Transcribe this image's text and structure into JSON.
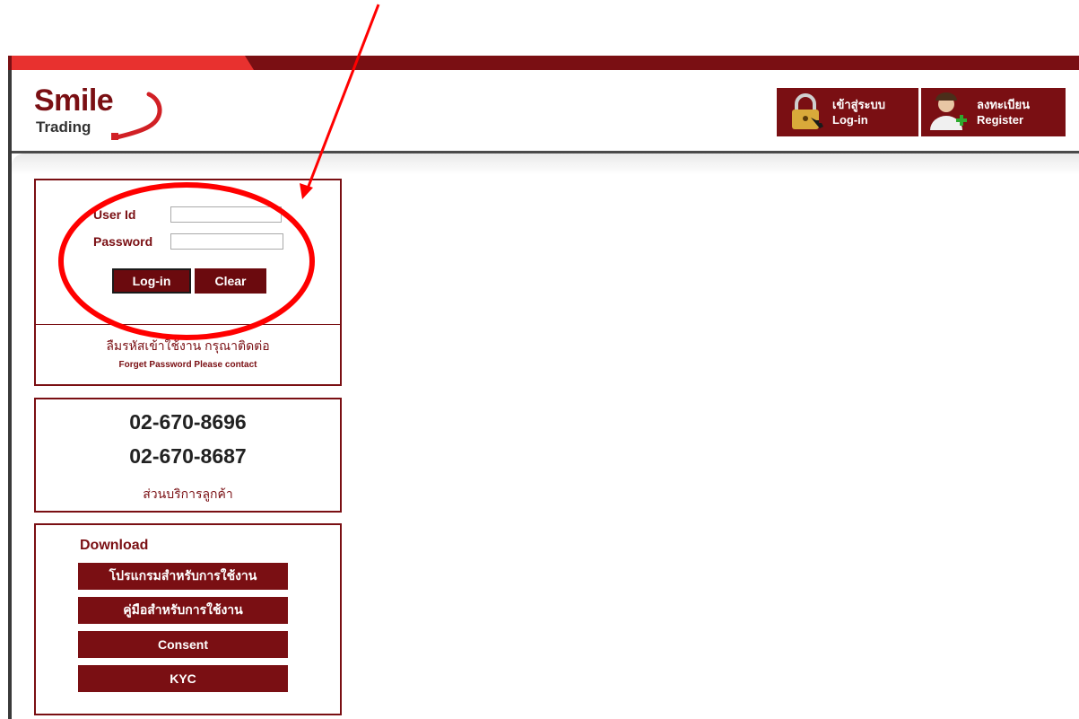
{
  "brand": {
    "logo_main": "Smile",
    "logo_sub": "Trading"
  },
  "header_nav": {
    "login_th": "เข้าสู่ระบบ",
    "login_en": "Log-in",
    "register_th": "ลงทะเบียน",
    "register_en": "Register"
  },
  "login_form": {
    "user_label": "User Id",
    "user_value": "",
    "password_label": "Password",
    "password_value": "",
    "login_button": "Log-in",
    "clear_button": "Clear",
    "forgot_th": "ลืมรหัสเข้าใช้งาน กรุณาติดต่อ",
    "forgot_en": "Forget Password Please contact"
  },
  "contact": {
    "phone_1": "02-670-8696",
    "phone_2": "02-670-8687",
    "label": "ส่วนบริการลูกค้า"
  },
  "download": {
    "title": "Download",
    "items": [
      "โปรแกรมสำหรับการใช้งาน",
      "คู่มือสำหรับการใช้งาน",
      "Consent",
      "KYC"
    ]
  },
  "colors": {
    "brand_dark_red": "#7a0f13",
    "accent_red": "#e8312f",
    "annotation_red": "#ff0000"
  }
}
